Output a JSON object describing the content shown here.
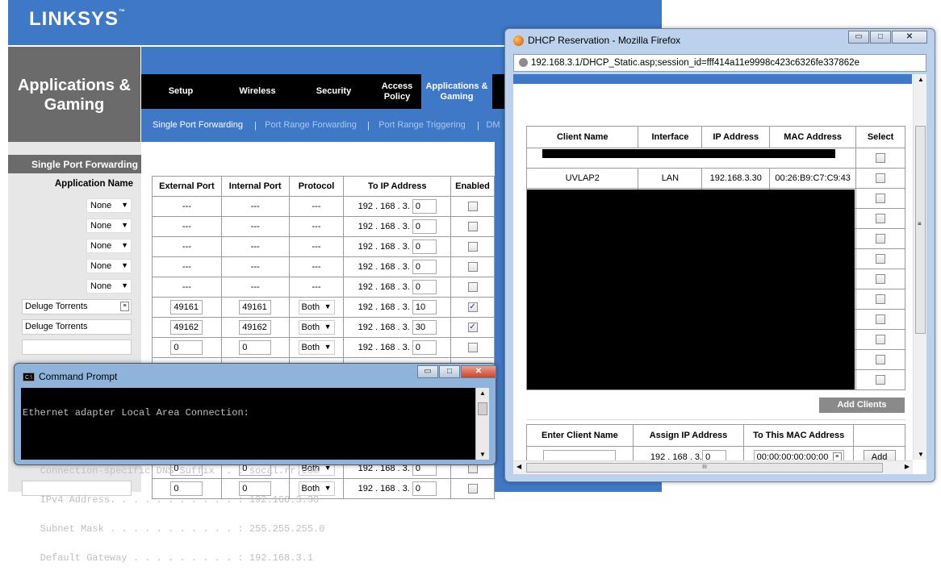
{
  "linksys": {
    "logo": "LINKSYS",
    "logo_mark": "™",
    "section_title_line1": "Applications &",
    "section_title_line2": "Gaming",
    "tabs": [
      {
        "label": "Setup"
      },
      {
        "label": "Wireless"
      },
      {
        "label": "Security"
      },
      {
        "label": "Access Policy"
      },
      {
        "label": "Applications & Gaming",
        "active": true
      }
    ],
    "subtabs": [
      {
        "label": "Single Port Forwarding"
      },
      {
        "label": "Port Range Forwarding"
      },
      {
        "label": "Port Range Triggering"
      },
      {
        "label": "DM"
      }
    ],
    "subtab_separator": "|",
    "sidebar_heading": "Single Port Forwarding",
    "app_name_label": "Application Name",
    "table": {
      "headers": [
        "External Port",
        "Internal Port",
        "Protocol",
        "To IP Address",
        "Enabled"
      ],
      "ip_prefix": "192 . 168 . 3.",
      "rows": [
        {
          "app": "None",
          "ext": "---",
          "int": "---",
          "proto": "---",
          "ip": "0",
          "enabled": false
        },
        {
          "app": "None",
          "ext": "---",
          "int": "---",
          "proto": "---",
          "ip": "0",
          "enabled": false
        },
        {
          "app": "None",
          "ext": "---",
          "int": "---",
          "proto": "---",
          "ip": "0",
          "enabled": false
        },
        {
          "app": "None",
          "ext": "---",
          "int": "---",
          "proto": "---",
          "ip": "0",
          "enabled": false
        },
        {
          "app": "None",
          "ext": "---",
          "int": "---",
          "proto": "---",
          "ip": "0",
          "enabled": false
        },
        {
          "app": "Deluge Torrents",
          "ext": "49161",
          "int": "49161",
          "proto": "Both",
          "ip": "10",
          "enabled": true
        },
        {
          "app": "Deluge Torrents",
          "ext": "49162",
          "int": "49162",
          "proto": "Both",
          "ip": "30",
          "enabled": true
        },
        {
          "app": "",
          "ext": "0",
          "int": "0",
          "proto": "Both",
          "ip": "0",
          "enabled": false
        }
      ],
      "bottom_rows": [
        {
          "ext": "0",
          "int": "0",
          "proto": "Both",
          "ip": "0"
        },
        {
          "ext": "0",
          "int": "0",
          "proto": "Both",
          "ip": "0"
        }
      ]
    }
  },
  "cmd": {
    "title": "Command Prompt",
    "icon_text": "C:\\",
    "lines": [
      "Ethernet adapter Local Area Connection:",
      "",
      "   Connection-specific DNS Suffix  . : socal.rr.com",
      "   IPv4 Address. . . . . . . . . . . : 192.168.3.30",
      "   Subnet Mask . . . . . . . . . . . : 255.255.255.0",
      "   Default Gateway . . . . . . . . . : 192.168.3.1"
    ]
  },
  "firefox": {
    "title": "DHCP Reservation - Mozilla Firefox",
    "url": "192.168.3.1/DHCP_Static.asp;session_id=fff414a11e9998c423c6326fe337862e",
    "clients_table": {
      "headers": [
        "Client Name",
        "Interface",
        "IP Address",
        "MAC Address",
        "Select"
      ],
      "rows": [
        {
          "name": "",
          "iface": "",
          "ip": "",
          "mac": ""
        },
        {
          "name": "UVLAP2",
          "iface": "LAN",
          "ip": "192.168.3.30",
          "mac": "00:26:B9:C7:C9:43"
        },
        {
          "name": "",
          "iface": "",
          "ip": "",
          "mac": ""
        },
        {
          "name": "",
          "iface": "",
          "ip": "",
          "mac": ""
        },
        {
          "name": "",
          "iface": "",
          "ip": "",
          "mac": ""
        },
        {
          "name": "",
          "iface": "",
          "ip": "",
          "mac": ""
        },
        {
          "name": "",
          "iface": "",
          "ip": "",
          "mac": ""
        },
        {
          "name": "",
          "iface": "",
          "ip": "",
          "mac": ""
        },
        {
          "name": "",
          "iface": "",
          "ip": "",
          "mac": ""
        },
        {
          "name": "",
          "iface": "",
          "ip": "",
          "mac": ""
        },
        {
          "name": "",
          "iface": "",
          "ip": "",
          "mac": ""
        },
        {
          "name": "",
          "iface": "",
          "ip": "",
          "mac": ""
        }
      ]
    },
    "add_clients_label": "Add Clients",
    "assign_table": {
      "headers": [
        "Enter Client Name",
        "Assign IP Address",
        "To This MAC Address",
        ""
      ],
      "ip_prefix": "192 . 168 . 3.",
      "ip_value": "0",
      "mac_value": "00:00:00:00:00:00",
      "add_label": "Add"
    },
    "scroll_grip": "≡",
    "hscroll_grip": "III"
  },
  "window_controls": {
    "minimize": "▭",
    "maximize": "□",
    "close": "✕"
  }
}
